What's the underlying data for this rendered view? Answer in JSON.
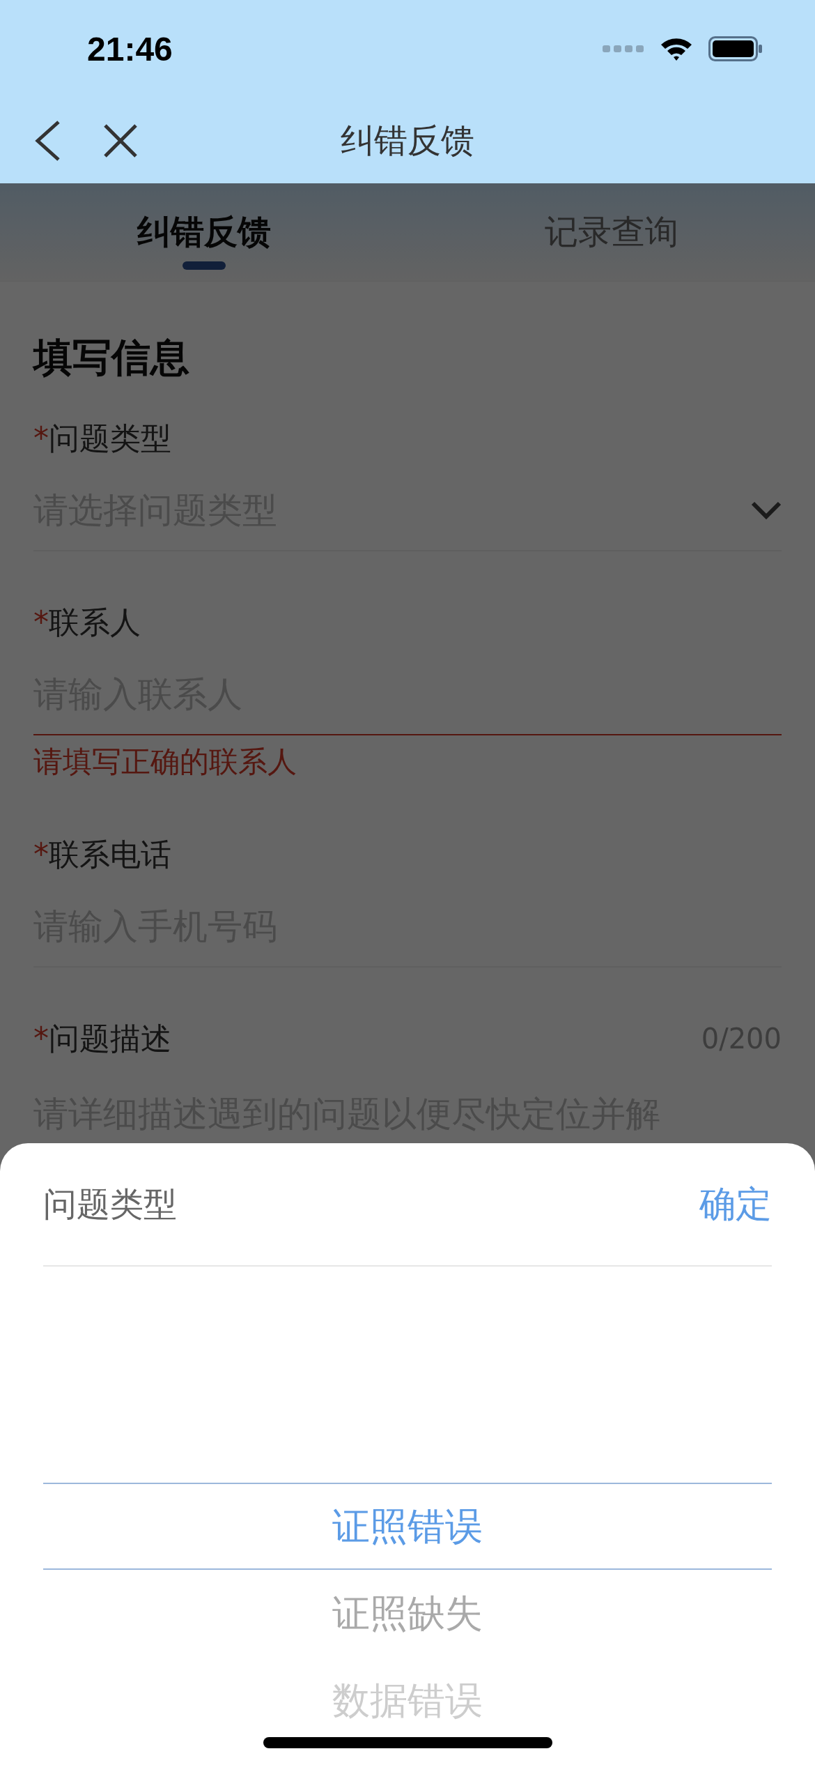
{
  "status_bar": {
    "time": "21:46"
  },
  "nav": {
    "title": "纠错反馈"
  },
  "tabs": [
    {
      "label": "纠错反馈",
      "selected": true
    },
    {
      "label": "记录查询",
      "selected": false
    }
  ],
  "form": {
    "title": "填写信息",
    "fields": [
      {
        "kind": "select",
        "required_mark": "*",
        "label": "问题类型",
        "placeholder": "请选择问题类型"
      },
      {
        "kind": "text",
        "required_mark": "*",
        "label": "联系人",
        "placeholder": "请输入联系人",
        "error": "请填写正确的联系人"
      },
      {
        "kind": "text",
        "required_mark": "*",
        "label": "联系电话",
        "placeholder": "请输入手机号码"
      },
      {
        "kind": "textarea",
        "required_mark": "*",
        "label": "问题描述",
        "counter": "0/200",
        "placeholder": "请详细描述遇到的问题以便尽快定位并解"
      }
    ]
  },
  "picker": {
    "title": "问题类型",
    "confirm": "确定",
    "options": [
      {
        "label": "证照错误",
        "selected": true
      },
      {
        "label": "证照缺失",
        "selected": false
      },
      {
        "label": "数据错误",
        "selected": false
      }
    ]
  }
}
